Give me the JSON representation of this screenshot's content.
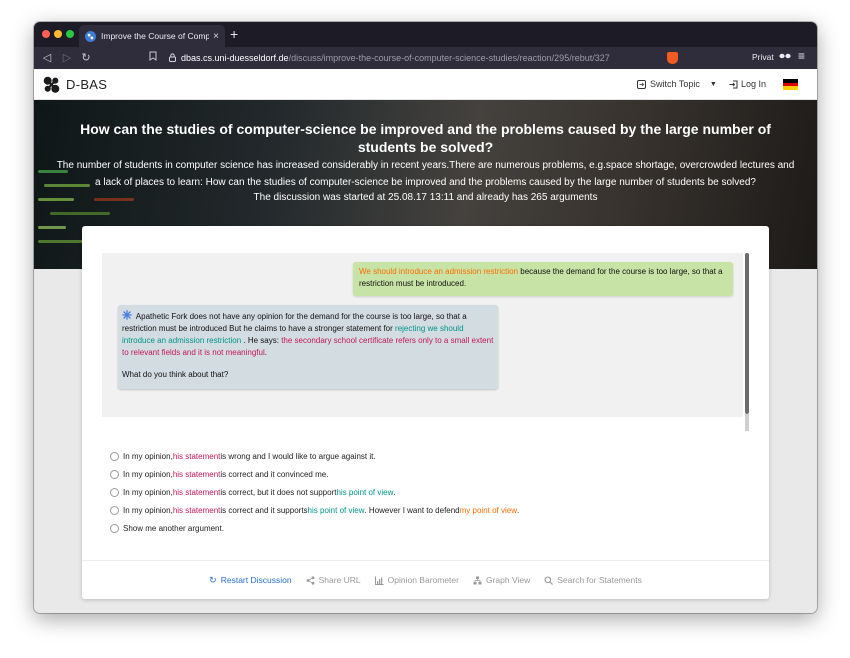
{
  "browser": {
    "tab_title": "Improve the Course of Computer-",
    "tab_close": "×",
    "new_tab": "+",
    "url_host": "dbas.cs.uni-duesseldorf.de",
    "url_path": "/discuss/improve-the-course-of-computer-science-studies/reaction/295/rebut/327",
    "private_label": "Privat",
    "menu_icon": "≡"
  },
  "site": {
    "logo_text": "D-BAS",
    "switch_topic": "Switch Topic",
    "login": "Log In",
    "flag": {
      "colors": [
        "#000000",
        "#dd0000",
        "#ffce00"
      ]
    }
  },
  "hero": {
    "title": "How can the studies of computer-science be improved and the problems caused by the large number of students be solved?",
    "description": "The number of students in computer science has increased considerably in recent years.There are numerous problems, e.g.space shortage, overcrowded lectures and a lack of places to learn: How can the studies of computer-science be improved and the problems caused by the large number of students be solved?",
    "info": "The discussion was started at 25.08.17 13:11 and already has 265 arguments"
  },
  "user_bubble": {
    "highlight": "We should introduce an admission restriction",
    "rest": " because the demand for the course is too large, so that a restriction must be introduced."
  },
  "system_bubble": {
    "part1": " Apathetic Fork does not have any opinion for the demand for the course is too large, so that a restriction must be introduced But he claims to have a stronger statement for ",
    "rejecting": "rejecting we should introduce an admission restriction",
    "part2": " . He says: ",
    "statement": "the secondary school certificate refers only to a small extent to relevant fields and it is not meaningful",
    "period": ".",
    "question": "What do you think about that?"
  },
  "options": [
    {
      "a": "In my opinion, ",
      "b": "his statement",
      "c": " is wrong and I would like to argue against it."
    },
    {
      "a": "In my opinion, ",
      "b": "his statement",
      "c": " is correct and it convinced me."
    },
    {
      "a": "In my opinion, ",
      "b": "his statement",
      "c": " is correct, but it does not support ",
      "d": "his point of view",
      "e": "."
    },
    {
      "a": "In my opinion, ",
      "b": "his statement",
      "c": " is correct and it supports ",
      "d": "his point of view",
      "e": ". However I want to defend ",
      "f": "my point of view",
      "g": "."
    },
    {
      "a": "Show me another argument."
    }
  ],
  "footer": {
    "restart": "Restart Discussion",
    "share": "Share URL",
    "barometer": "Opinion Barometer",
    "graph": "Graph View",
    "search": "Search for Statements"
  },
  "colors": {
    "accent": "#2a6fd1",
    "user_bubble": "#c7e3a6",
    "system_bubble": "#d3dce1",
    "orange": "#ff6d00",
    "teal": "#00948a",
    "magenta": "#c2185b"
  }
}
